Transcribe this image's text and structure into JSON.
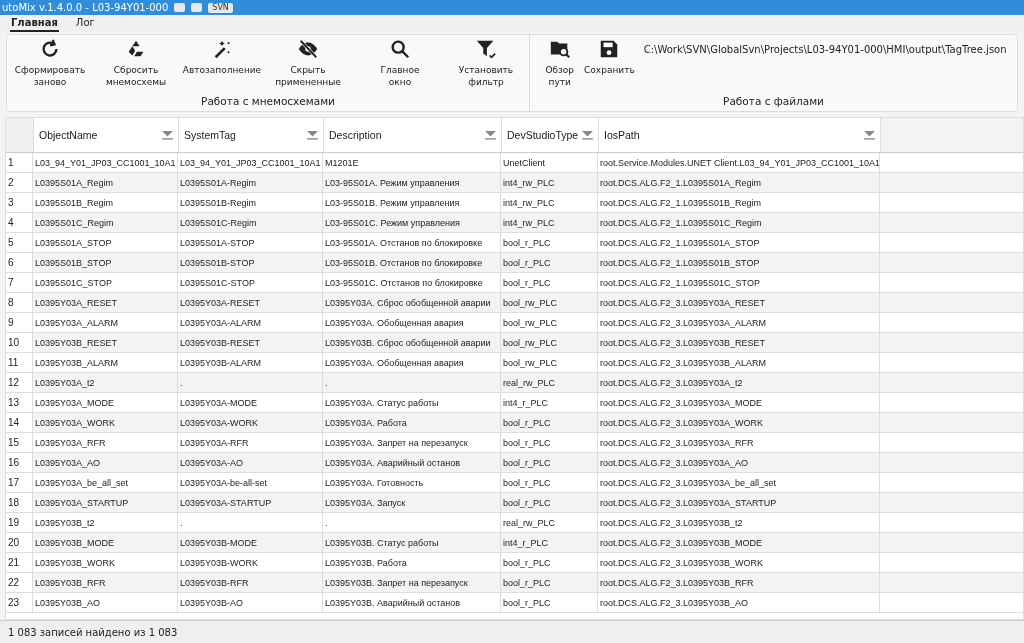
{
  "window": {
    "title": "utoMix v.1.4.0.0 - L03-94Y01-000",
    "badge": "SVN"
  },
  "tabs": [
    {
      "label": "Главная",
      "selected": true
    },
    {
      "label": "Лог",
      "selected": false
    }
  ],
  "ribbon": {
    "groups": [
      {
        "label": "Работа с мнемосхемами",
        "buttons": [
          "Сформировать\nзаново",
          "Сбросить\nмнемосхемы",
          "Автозаполнение",
          "Скрыть\nпримененные",
          "Главное\nокно",
          "Установить\nфильтр"
        ]
      },
      {
        "label": "Работа с файлами",
        "path": "C:\\Work\\SVN\\GlobalSvn\\Projects\\L03-94Y01-000\\HMI\\output\\TagTree.json",
        "buttons": [
          "Обзор\nпути",
          "Сохранить"
        ]
      }
    ]
  },
  "table": {
    "columns": [
      "ObjectName",
      "SystemTag",
      "Description",
      "DevStudioType",
      "IosPath"
    ],
    "rows": [
      {
        "number": "1",
        "cells": [
          "L03_94_Y01_JP03_CC1001_10A1",
          "L03_94_Y01_JP03_CC1001_10A1",
          "M1201E",
          "UnetClient",
          "root.Service.Modules.UNET Client.L03_94_Y01_JP03_CC1001_10A1"
        ]
      },
      {
        "number": "2",
        "cells": [
          "L0395S01A_Regim",
          "L0395S01A-Regim",
          "L03-95S01A. Режим управления",
          "int4_rw_PLC",
          "root.DCS.ALG.F2_1.L0395S01A_Regim"
        ]
      },
      {
        "number": "3",
        "cells": [
          "L0395S01B_Regim",
          "L0395S01B-Regim",
          "L03-95S01B. Режим управления",
          "int4_rw_PLC",
          "root.DCS.ALG.F2_1.L0395S01B_Regim"
        ]
      },
      {
        "number": "4",
        "cells": [
          "L0395S01C_Regim",
          "L0395S01C-Regim",
          "L03-95S01C. Режим управления",
          "int4_rw_PLC",
          "root.DCS.ALG.F2_1.L0395S01C_Regim"
        ]
      },
      {
        "number": "5",
        "cells": [
          "L0395S01A_STOP",
          "L0395S01A-STOP",
          "L03-95S01A. Отстанов по блокировке",
          "bool_r_PLC",
          "root.DCS.ALG.F2_1.L0395S01A_STOP"
        ]
      },
      {
        "number": "6",
        "cells": [
          "L0395S01B_STOP",
          "L0395S01B-STOP",
          "L03-95S01B. Отстанов по блокировке",
          "bool_r_PLC",
          "root.DCS.ALG.F2_1.L0395S01B_STOP"
        ]
      },
      {
        "number": "7",
        "cells": [
          "L0395S01C_STOP",
          "L0395S01C-STOP",
          "L03-95S01C. Отстанов по блокировке",
          "bool_r_PLC",
          "root.DCS.ALG.F2_1.L0395S01C_STOP"
        ]
      },
      {
        "number": "8",
        "cells": [
          "L0395Y03A_RESET",
          "L0395Y03A-RESET",
          "L0395Y03A. Сброс обобщенной аварии",
          "bool_rw_PLC",
          "root.DCS.ALG.F2_3.L0395Y03A_RESET"
        ]
      },
      {
        "number": "9",
        "cells": [
          "L0395Y03A_ALARM",
          "L0395Y03A-ALARM",
          "L0395Y03A. Обобщенная авария",
          "bool_rw_PLC",
          "root.DCS.ALG.F2_3.L0395Y03A_ALARM"
        ]
      },
      {
        "number": "10",
        "cells": [
          "L0395Y03B_RESET",
          "L0395Y03B-RESET",
          "L0395Y03B. Сброс обобщенной аварии",
          "bool_rw_PLC",
          "root.DCS.ALG.F2_3.L0395Y03B_RESET"
        ]
      },
      {
        "number": "11",
        "cells": [
          "L0395Y03B_ALARM",
          "L0395Y03B-ALARM",
          "L0395Y03A. Обобщенная авария",
          "bool_rw_PLC",
          "root.DCS.ALG.F2_3.L0395Y03B_ALARM"
        ]
      },
      {
        "number": "12",
        "cells": [
          "L0395Y03A_t2",
          ".",
          ".",
          "real_rw_PLC",
          "root.DCS.ALG.F2_3.L0395Y03A_t2"
        ]
      },
      {
        "number": "13",
        "cells": [
          "L0395Y03A_MODE",
          "L0395Y03A-MODE",
          "L0395Y03A. Статус работы",
          "int4_r_PLC",
          "root.DCS.ALG.F2_3.L0395Y03A_MODE"
        ]
      },
      {
        "number": "14",
        "cells": [
          "L0395Y03A_WORK",
          "L0395Y03A-WORK",
          "L0395Y03A. Работа",
          "bool_r_PLC",
          "root.DCS.ALG.F2_3.L0395Y03A_WORK"
        ]
      },
      {
        "number": "15",
        "cells": [
          "L0395Y03A_RFR",
          "L0395Y03A-RFR",
          "L0395Y03A. Запрет на перезапуск",
          "bool_r_PLC",
          "root.DCS.ALG.F2_3.L0395Y03A_RFR"
        ]
      },
      {
        "number": "16",
        "cells": [
          "L0395Y03A_AO",
          "L0395Y03A-AO",
          "L0395Y03A. Аварийный останов",
          "bool_r_PLC",
          "root.DCS.ALG.F2_3.L0395Y03A_AO"
        ]
      },
      {
        "number": "17",
        "cells": [
          "L0395Y03A_be_all_set",
          "L0395Y03A-be-all-set",
          "L0395Y03A. Готовность",
          "bool_r_PLC",
          "root.DCS.ALG.F2_3.L0395Y03A_be_all_set"
        ]
      },
      {
        "number": "18",
        "cells": [
          "L0395Y03A_STARTUP",
          "L0395Y03A-STARTUP",
          "L0395Y03A. Запуск",
          "bool_r_PLC",
          "root.DCS.ALG.F2_3.L0395Y03A_STARTUP"
        ]
      },
      {
        "number": "19",
        "cells": [
          "L0395Y03B_t2",
          ".",
          ".",
          "real_rw_PLC",
          "root.DCS.ALG.F2_3.L0395Y03B_t2"
        ]
      },
      {
        "number": "20",
        "cells": [
          "L0395Y03B_MODE",
          "L0395Y03B-MODE",
          "L0395Y03B. Статус работы",
          "int4_r_PLC",
          "root.DCS.ALG.F2_3.L0395Y03B_MODE"
        ]
      },
      {
        "number": "21",
        "cells": [
          "L0395Y03B_WORK",
          "L0395Y03B-WORK",
          "L0395Y03B. Работа",
          "bool_r_PLC",
          "root.DCS.ALG.F2_3.L0395Y03B_WORK"
        ]
      },
      {
        "number": "22",
        "cells": [
          "L0395Y03B_RFR",
          "L0395Y03B-RFR",
          "L0395Y03B. Запрет на перезапуск",
          "bool_r_PLC",
          "root.DCS.ALG.F2_3.L0395Y03B_RFR"
        ]
      },
      {
        "number": "23",
        "cells": [
          "L0395Y03B_AO",
          "L0395Y03B-AO",
          "L0395Y03B. Аварийный останов",
          "bool_r_PLC",
          "root.DCS.ALG.F2_3.L0395Y03B_AO"
        ]
      }
    ]
  },
  "status_bar": "1 083 записей найдено из 1 083"
}
